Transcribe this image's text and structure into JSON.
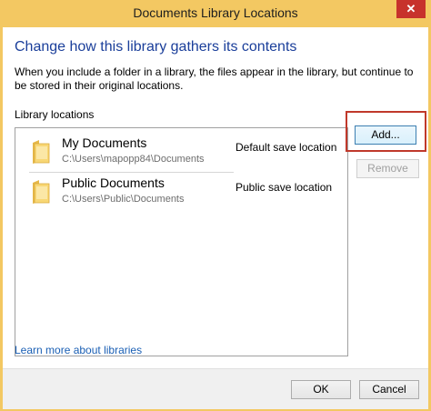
{
  "window": {
    "title": "Documents Library Locations",
    "close_glyph": "✕"
  },
  "content": {
    "heading": "Change how this library gathers its contents",
    "description": "When you include a folder in a library, the files appear in the library, but continue to be stored in their original locations.",
    "locations_label": "Library locations"
  },
  "locations": [
    {
      "name": "My Documents",
      "path": "C:\\Users\\mapopp84\\Documents",
      "tag": "Default save location",
      "icon": "folder-icon"
    },
    {
      "name": "Public Documents",
      "path": "C:\\Users\\Public\\Documents",
      "tag": "Public save location",
      "icon": "folder-icon"
    }
  ],
  "buttons": {
    "add": "Add...",
    "remove": "Remove",
    "ok": "OK",
    "cancel": "Cancel"
  },
  "link": {
    "learn_more": "Learn more about libraries"
  },
  "colors": {
    "titlebar": "#f3c862",
    "close": "#c7322c",
    "heading": "#1a3e9a",
    "highlight": "#c0392b",
    "link": "#1a5fb4"
  }
}
